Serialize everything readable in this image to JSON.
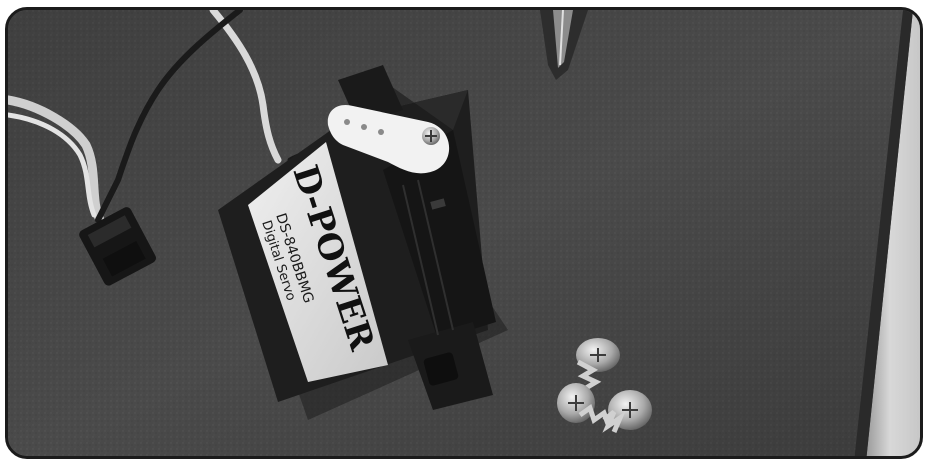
{
  "photo": {
    "subject": "servo-with-horn-and-screws",
    "tone": "grayscale"
  },
  "servo_label": {
    "brand": "D-POWER",
    "model": "DS-840BBMG",
    "type": "Digital Servo"
  },
  "colors": {
    "frame_border": "#1b1b1b",
    "carpet": "#4b4b4b",
    "servo_body": "#1e1e1e",
    "label_panel": "#e6e6e6",
    "horn": "#f2f2f2",
    "screw_metal": "#b9b9b9",
    "wood_edge": "#cfcfcf"
  }
}
